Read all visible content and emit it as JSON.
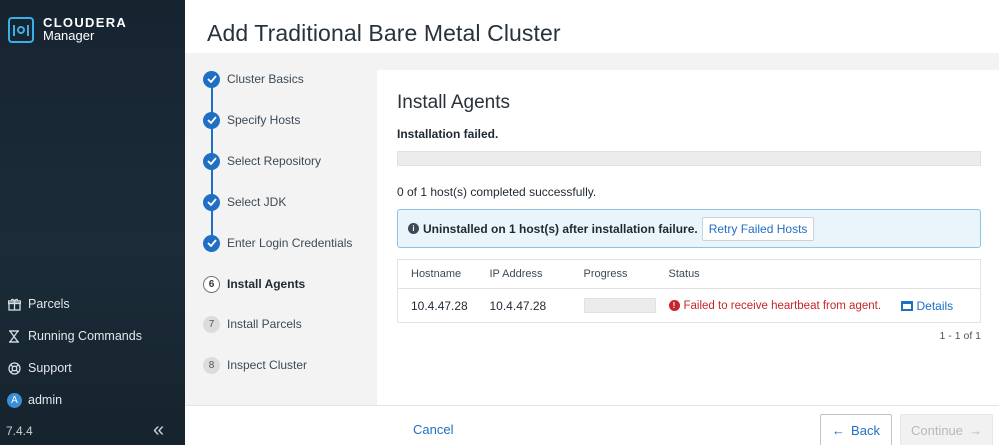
{
  "sidebar": {
    "brand": "CLOUDERA",
    "product": "Manager",
    "nav": [
      {
        "label": "Parcels",
        "icon": "gift-icon"
      },
      {
        "label": "Running Commands",
        "icon": "hourglass-icon"
      },
      {
        "label": "Support",
        "icon": "lifebuoy-icon"
      },
      {
        "label": "admin",
        "icon": "avatar-icon",
        "avatar_letter": "A"
      }
    ],
    "version": "7.4.4",
    "collapse_glyph": "«"
  },
  "header": {
    "title": "Add Traditional Bare Metal Cluster"
  },
  "steps": [
    {
      "label": "Cluster Basics",
      "state": "done"
    },
    {
      "label": "Specify Hosts",
      "state": "done"
    },
    {
      "label": "Select Repository",
      "state": "done"
    },
    {
      "label": "Select JDK",
      "state": "done"
    },
    {
      "label": "Enter Login Credentials",
      "state": "done"
    },
    {
      "label": "Install Agents",
      "state": "current",
      "number": "6"
    },
    {
      "label": "Install Parcels",
      "state": "pending",
      "number": "7"
    },
    {
      "label": "Inspect Cluster",
      "state": "pending",
      "number": "8"
    }
  ],
  "main": {
    "title": "Install Agents",
    "status": "Installation failed.",
    "progress_fraction": 0,
    "completed_text": "0 of 1 host(s) completed successfully.",
    "alert_text": "Uninstalled on 1 host(s) after installation failure.",
    "retry_label": "Retry Failed Hosts",
    "table": {
      "columns": [
        "Hostname",
        "IP Address",
        "Progress",
        "Status",
        ""
      ],
      "rows": [
        {
          "hostname": "10.4.47.28",
          "ip": "10.4.47.28",
          "progress_fraction": 0,
          "status": "Failed to receive heartbeat from agent.",
          "action": "Details"
        }
      ]
    },
    "pager": "1 - 1 of 1"
  },
  "footer": {
    "cancel_label": "Cancel",
    "back_label": "Back",
    "continue_label": "Continue"
  },
  "colors": {
    "accent": "#1f6fc5",
    "error": "#c7252b",
    "sidebar_bg": "#1b2c38",
    "alert_bg": "#e9f4fb"
  }
}
